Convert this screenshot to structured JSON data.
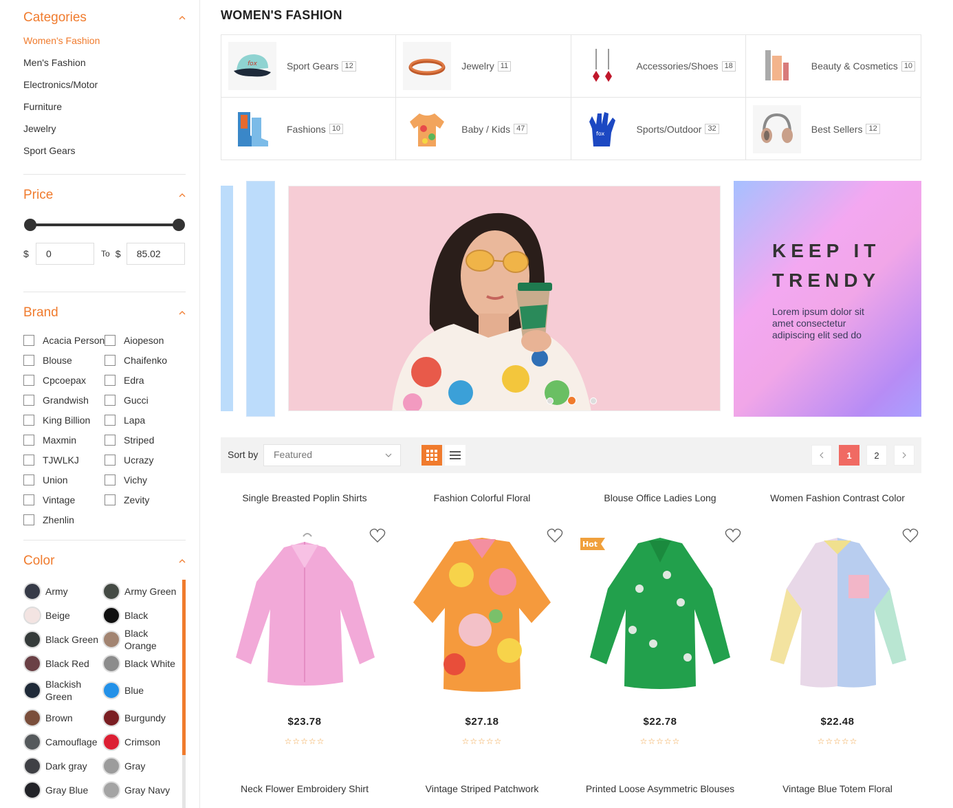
{
  "sidebar": {
    "categories": {
      "title": "Categories",
      "items": [
        "Women's Fashion",
        "Men's Fashion",
        "Electronics/Motor",
        "Furniture",
        "Jewelry",
        "Sport Gears"
      ]
    },
    "price": {
      "title": "Price",
      "currency": "$",
      "to_label": "To",
      "min": "0",
      "max": "85.02"
    },
    "brand": {
      "title": "Brand",
      "items": [
        "Acacia Person",
        "Aiopeson",
        "Blouse",
        "Chaifenko",
        "Cpcoepax",
        "Edra",
        "Grandwish",
        "Gucci",
        "King Billion",
        "Lapa",
        "Maxmin",
        "Striped",
        "TJWLKJ",
        "Ucrazy",
        "Union",
        "Vichy",
        "Vintage",
        "Zevity",
        "Zhenlin"
      ]
    },
    "color": {
      "title": "Color",
      "items": [
        {
          "name": "Army",
          "hex": "#363a47"
        },
        {
          "name": "Army Green",
          "hex": "#444a44"
        },
        {
          "name": "Beige",
          "hex": "#f3e4e2"
        },
        {
          "name": "Black",
          "hex": "#111111"
        },
        {
          "name": "Black Green",
          "hex": "#353b3a"
        },
        {
          "name": "Black Orange",
          "hex": "#a28471"
        },
        {
          "name": "Black Red",
          "hex": "#6a4045"
        },
        {
          "name": "Black White",
          "hex": "#8c8c8c"
        },
        {
          "name": "Blackish Green",
          "hex": "#1f2a38"
        },
        {
          "name": "Blue",
          "hex": "#2391e8"
        },
        {
          "name": "Brown",
          "hex": "#7a4e3b"
        },
        {
          "name": "Burgundy",
          "hex": "#7a1e22"
        },
        {
          "name": "Camouflage",
          "hex": "#55595c"
        },
        {
          "name": "Crimson",
          "hex": "#dc1f33"
        },
        {
          "name": "Dark gray",
          "hex": "#3f4045"
        },
        {
          "name": "Gray",
          "hex": "#9c9c9c"
        },
        {
          "name": "Gray Blue",
          "hex": "#222328"
        },
        {
          "name": "Gray Navy",
          "hex": "#a4a4a4"
        }
      ]
    }
  },
  "main": {
    "title": "WOMEN'S FASHION",
    "categories": [
      {
        "name": "Sport Gears",
        "count": "12",
        "icon": "cap-icon"
      },
      {
        "name": "Jewelry",
        "count": "11",
        "icon": "bracelet-icon"
      },
      {
        "name": "Accessories/Shoes",
        "count": "18",
        "icon": "earrings-icon"
      },
      {
        "name": "Beauty & Cosmetics",
        "count": "10",
        "icon": "cosmetics-icon"
      },
      {
        "name": "Fashions",
        "count": "10",
        "icon": "boots-icon"
      },
      {
        "name": "Baby / Kids",
        "count": "47",
        "icon": "shirt-icon"
      },
      {
        "name": "Sports/Outdoor",
        "count": "32",
        "icon": "glove-icon"
      },
      {
        "name": "Best Sellers",
        "count": "12",
        "icon": "headphones-icon"
      }
    ],
    "promo": {
      "heading_1": "KEEP IT",
      "heading_2": "TRENDY",
      "text": "Lorem ipsum dolor sit amet consectetur adipiscing elit sed do"
    },
    "toolbar": {
      "sort_label": "Sort by",
      "sort_value": "Featured",
      "pages": [
        "1",
        "2"
      ],
      "current_page": "1"
    },
    "products": [
      {
        "name": "Single Breasted Poplin Shirts",
        "price": "$23.78",
        "badge": "",
        "color": "#f2a9d8"
      },
      {
        "name": "Fashion Colorful Floral",
        "price": "$27.18",
        "badge": "",
        "color": "#f59a3d"
      },
      {
        "name": "Blouse Office Ladies Long",
        "price": "$22.78",
        "badge": "Hot",
        "color": "#22a04c"
      },
      {
        "name": "Women Fashion Contrast Color",
        "price": "$22.48",
        "badge": "",
        "color": "#c3d2ef"
      },
      {
        "name": "Neck Flower Embroidery Shirt",
        "price": "",
        "badge": "",
        "color": ""
      },
      {
        "name": "Vintage Striped Patchwork",
        "price": "",
        "badge": "",
        "color": ""
      },
      {
        "name": "Printed Loose Asymmetric Blouses",
        "price": "",
        "badge": "",
        "color": ""
      },
      {
        "name": "Vintage Blue Totem Floral",
        "price": "",
        "badge": "",
        "color": ""
      }
    ],
    "rating_stars": "☆☆☆☆☆",
    "accent": "#f07b2d"
  }
}
